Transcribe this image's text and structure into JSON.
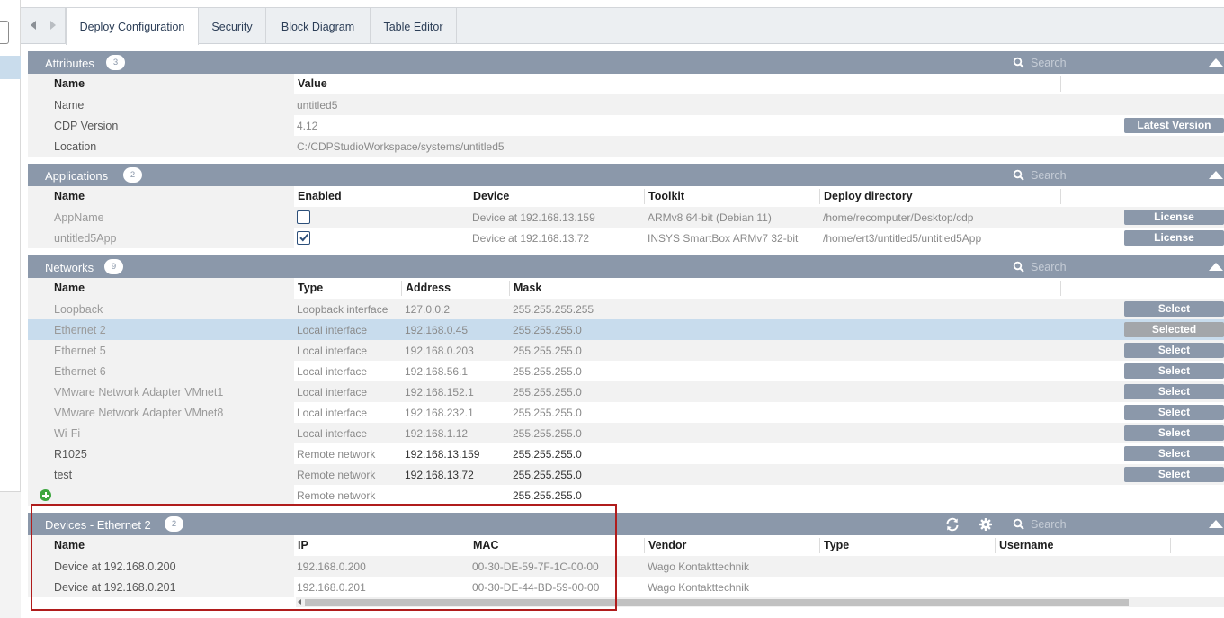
{
  "tabs": [
    {
      "label": "Deploy Configuration",
      "active": true
    },
    {
      "label": "Security",
      "active": false
    },
    {
      "label": "Block Diagram",
      "active": false
    },
    {
      "label": "Table Editor",
      "active": false
    }
  ],
  "search_placeholder": "Search",
  "attributes": {
    "title": "Attributes",
    "count": "3",
    "headers": {
      "name": "Name",
      "value": "Value"
    },
    "rows": [
      {
        "name": "Name",
        "value": "untitled5"
      },
      {
        "name": "CDP Version",
        "value": "4.12",
        "button": "Latest Version"
      },
      {
        "name": "Location",
        "value": "C:/CDPStudioWorkspace/systems/untitled5"
      }
    ]
  },
  "applications": {
    "title": "Applications",
    "count": "2",
    "headers": {
      "name": "Name",
      "enabled": "Enabled",
      "device": "Device",
      "toolkit": "Toolkit",
      "deploy_dir": "Deploy directory"
    },
    "rows": [
      {
        "name": "AppName",
        "enabled": false,
        "device": "Device at 192.168.13.159",
        "toolkit": "ARMv8 64-bit (Debian 11)",
        "deploy_dir": "/home/recomputer/Desktop/cdp",
        "button": "License"
      },
      {
        "name": "untitled5App",
        "enabled": true,
        "device": "Device at 192.168.13.72",
        "toolkit": "INSYS SmartBox ARMv7 32-bit",
        "deploy_dir": "/home/ert3/untitled5/untitled5App",
        "button": "License"
      }
    ]
  },
  "networks": {
    "title": "Networks",
    "count": "9",
    "headers": {
      "name": "Name",
      "type": "Type",
      "address": "Address",
      "mask": "Mask"
    },
    "rows": [
      {
        "name": "Loopback",
        "type": "Loopback interface",
        "address": "127.0.0.2",
        "mask": "255.255.255.255",
        "button": "Select"
      },
      {
        "name": "Ethernet 2",
        "type": "Local interface",
        "address": "192.168.0.45",
        "mask": "255.255.255.0",
        "button": "Selected"
      },
      {
        "name": "Ethernet 5",
        "type": "Local interface",
        "address": "192.168.0.203",
        "mask": "255.255.255.0",
        "button": "Select"
      },
      {
        "name": "Ethernet 6",
        "type": "Local interface",
        "address": "192.168.56.1",
        "mask": "255.255.255.0",
        "button": "Select"
      },
      {
        "name": "VMware Network Adapter VMnet1",
        "type": "Local interface",
        "address": "192.168.152.1",
        "mask": "255.255.255.0",
        "button": "Select"
      },
      {
        "name": "VMware Network Adapter VMnet8",
        "type": "Local interface",
        "address": "192.168.232.1",
        "mask": "255.255.255.0",
        "button": "Select"
      },
      {
        "name": "Wi-Fi",
        "type": "Local interface",
        "address": "192.168.1.12",
        "mask": "255.255.255.0",
        "button": "Select"
      },
      {
        "name": "R1025",
        "type": "Remote network",
        "address": "192.168.13.159",
        "mask": "255.255.255.0",
        "button": "Select"
      },
      {
        "name": "test",
        "type": "Remote network",
        "address": "192.168.13.72",
        "mask": "255.255.255.0",
        "button": "Select"
      }
    ],
    "new_row": {
      "type": "Remote network",
      "mask": "255.255.255.0"
    }
  },
  "devices": {
    "title": "Devices - Ethernet 2",
    "count": "2",
    "headers": {
      "name": "Name",
      "ip": "IP",
      "mac": "MAC",
      "vendor": "Vendor",
      "type": "Type",
      "username": "Username"
    },
    "rows": [
      {
        "name": "Device at 192.168.0.200",
        "ip": "192.168.0.200",
        "mac": "00-30-DE-59-7F-1C-00-00",
        "vendor": "Wago Kontakttechnik"
      },
      {
        "name": "Device at 192.168.0.201",
        "ip": "192.168.0.201",
        "mac": "00-30-DE-44-BD-59-00-00",
        "vendor": "Wago Kontakttechnik"
      }
    ]
  },
  "colors": {
    "header_bg": "#8b98aa",
    "selected_row": "#c8dced",
    "highlight_box": "#b01c1c"
  }
}
